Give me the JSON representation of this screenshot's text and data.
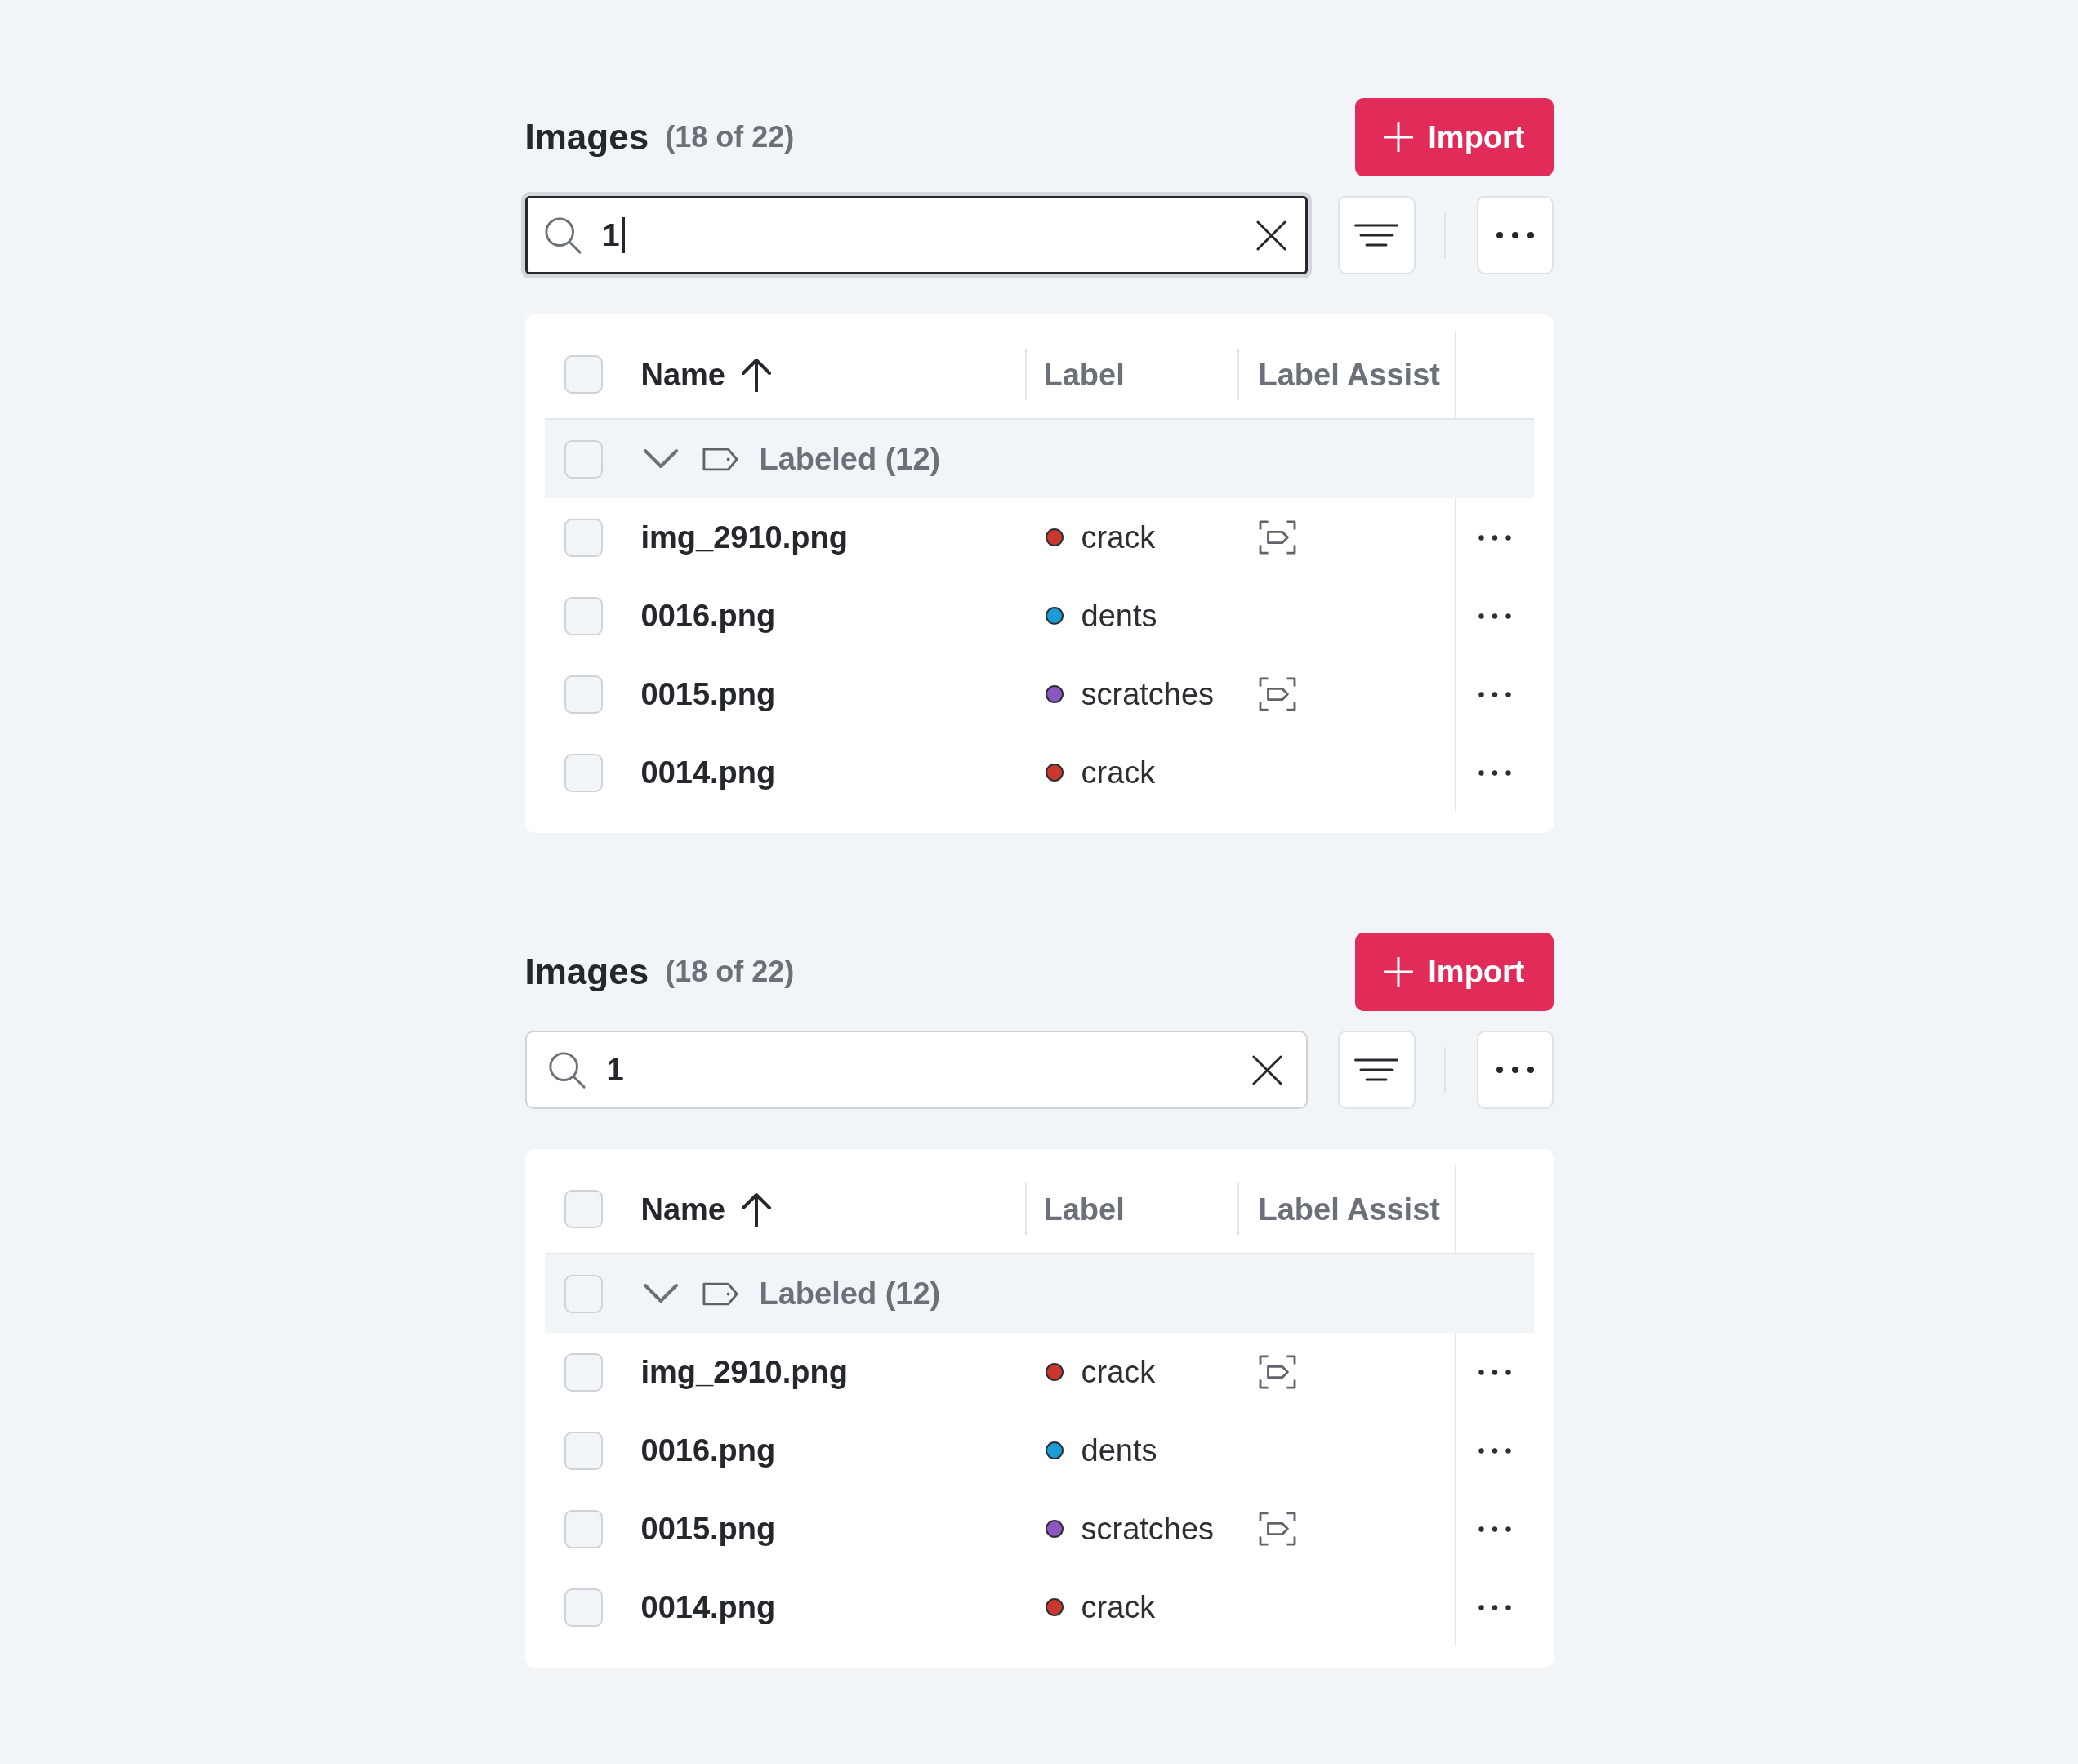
{
  "panels": [
    {
      "title": "Images",
      "count": "(18 of 22)",
      "import_button": "Import",
      "search": {
        "value": "1",
        "focused": true
      },
      "table": {
        "header_checked": false,
        "columns": [
          {
            "label": "Name",
            "sorted": true
          },
          {
            "label": "Label",
            "sorted": false
          },
          {
            "label": "Label Assist",
            "sorted": false
          }
        ],
        "groups": [
          {
            "label": "Labeled (12)",
            "checked": false,
            "expanded": true,
            "rows": [
              {
                "name": "img_2910.png",
                "checked": false,
                "label": "crack",
                "color": "#c9382e",
                "label_assist": true
              },
              {
                "name": "0016.png",
                "checked": false,
                "label": "dents",
                "color": "#1b9bd8",
                "label_assist": false
              },
              {
                "name": "0015.png",
                "checked": false,
                "label": "scratches",
                "color": "#8c56c1",
                "label_assist": true
              },
              {
                "name": "0014.png",
                "checked": false,
                "label": "crack",
                "color": "#c9382e",
                "label_assist": false
              }
            ]
          }
        ]
      }
    },
    {
      "title": "Images",
      "count": "(18 of 22)",
      "import_button": "Import",
      "search": {
        "value": "1",
        "focused": false
      },
      "table": {
        "header_checked": false,
        "columns": [
          {
            "label": "Name",
            "sorted": true
          },
          {
            "label": "Label",
            "sorted": false
          },
          {
            "label": "Label Assist",
            "sorted": false
          }
        ],
        "groups": [
          {
            "label": "Labeled (12)",
            "checked": false,
            "expanded": true,
            "rows": [
              {
                "name": "img_2910.png",
                "checked": false,
                "label": "crack",
                "color": "#c9382e",
                "label_assist": true
              },
              {
                "name": "0016.png",
                "checked": false,
                "label": "dents",
                "color": "#1b9bd8",
                "label_assist": false
              },
              {
                "name": "0015.png",
                "checked": false,
                "label": "scratches",
                "color": "#8c56c1",
                "label_assist": true
              },
              {
                "name": "0014.png",
                "checked": false,
                "label": "crack",
                "color": "#c9382e",
                "label_assist": false
              }
            ]
          }
        ]
      }
    }
  ]
}
